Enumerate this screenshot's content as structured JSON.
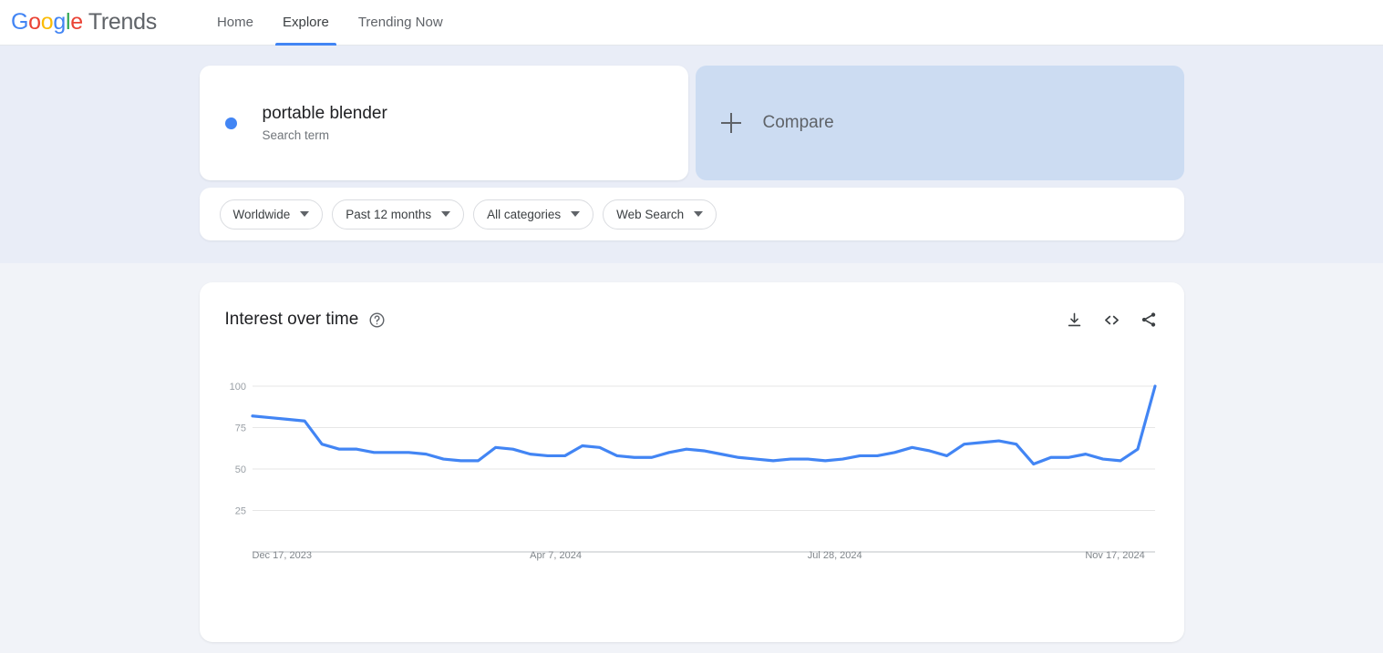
{
  "header": {
    "brand_google": "Google",
    "brand_trends": "Trends",
    "nav": [
      {
        "label": "Home",
        "active": false
      },
      {
        "label": "Explore",
        "active": true
      },
      {
        "label": "Trending Now",
        "active": false
      }
    ]
  },
  "query": {
    "term_title": "portable blender",
    "term_subtitle": "Search term",
    "term_dot_color": "#4285f4",
    "compare_label": "Compare",
    "compare_plus_icon": "plus-icon",
    "filters": [
      {
        "label": "Worldwide"
      },
      {
        "label": "Past 12 months"
      },
      {
        "label": "All categories"
      },
      {
        "label": "Web Search"
      }
    ]
  },
  "chart_card": {
    "title": "Interest over time",
    "help_icon": "help-circle-icon",
    "actions": [
      {
        "name": "download-icon",
        "label": "Download"
      },
      {
        "name": "embed-code-icon",
        "label": "Embed"
      },
      {
        "name": "share-icon",
        "label": "Share"
      }
    ]
  },
  "chart_data": {
    "type": "line",
    "title": "Interest over time",
    "xlabel": "",
    "ylabel": "",
    "ylim": [
      0,
      100
    ],
    "yticks": [
      25,
      50,
      75,
      100
    ],
    "grid": true,
    "legend": false,
    "line_color": "#4285f4",
    "series_name": "portable blender",
    "xtick_labels": [
      "Dec 17, 2023",
      "Apr 7, 2024",
      "Jul 28, 2024",
      "Nov 17, 2024"
    ],
    "xtick_indices": [
      0,
      16,
      32,
      48
    ],
    "x": [
      "Dec 17, 2023",
      "Dec 24, 2023",
      "Dec 31, 2023",
      "Jan 7, 2024",
      "Jan 14, 2024",
      "Jan 21, 2024",
      "Jan 28, 2024",
      "Feb 4, 2024",
      "Feb 11, 2024",
      "Feb 18, 2024",
      "Feb 25, 2024",
      "Mar 3, 2024",
      "Mar 10, 2024",
      "Mar 17, 2024",
      "Mar 24, 2024",
      "Mar 31, 2024",
      "Apr 7, 2024",
      "Apr 14, 2024",
      "Apr 21, 2024",
      "Apr 28, 2024",
      "May 5, 2024",
      "May 12, 2024",
      "May 19, 2024",
      "May 26, 2024",
      "Jun 2, 2024",
      "Jun 9, 2024",
      "Jun 16, 2024",
      "Jun 23, 2024",
      "Jun 30, 2024",
      "Jul 7, 2024",
      "Jul 14, 2024",
      "Jul 21, 2024",
      "Jul 28, 2024",
      "Aug 4, 2024",
      "Aug 11, 2024",
      "Aug 18, 2024",
      "Aug 25, 2024",
      "Sep 1, 2024",
      "Sep 8, 2024",
      "Sep 15, 2024",
      "Sep 22, 2024",
      "Sep 29, 2024",
      "Oct 6, 2024",
      "Oct 13, 2024",
      "Oct 20, 2024",
      "Oct 27, 2024",
      "Nov 3, 2024",
      "Nov 10, 2024",
      "Nov 17, 2024",
      "Nov 24, 2024",
      "Dec 1, 2024",
      "Dec 8, 2024",
      "Dec 15, 2024"
    ],
    "values": [
      82,
      81,
      80,
      79,
      65,
      62,
      62,
      60,
      60,
      60,
      59,
      56,
      55,
      55,
      63,
      62,
      59,
      58,
      58,
      64,
      63,
      58,
      57,
      57,
      60,
      62,
      61,
      59,
      57,
      56,
      55,
      56,
      56,
      55,
      56,
      58,
      58,
      60,
      63,
      61,
      58,
      65,
      66,
      67,
      65,
      53,
      57,
      57,
      59,
      56,
      55,
      62,
      100
    ]
  }
}
